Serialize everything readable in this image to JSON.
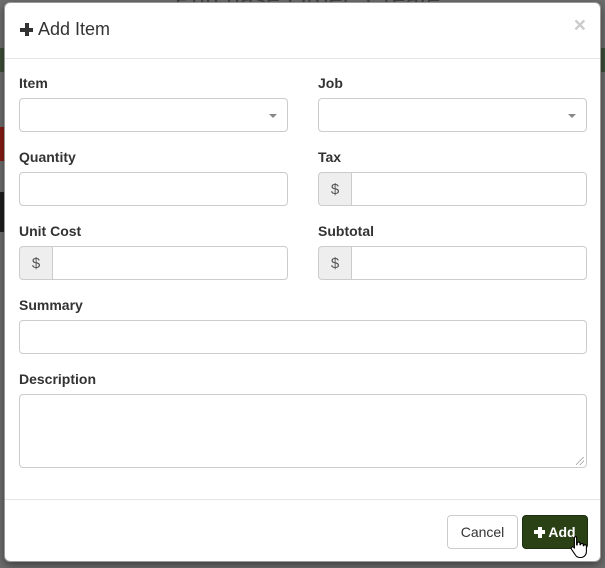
{
  "modal": {
    "title": "Add Item",
    "close_label": "×"
  },
  "form": {
    "item": {
      "label": "Item",
      "value": ""
    },
    "job": {
      "label": "Job",
      "value": ""
    },
    "quantity": {
      "label": "Quantity",
      "value": ""
    },
    "tax": {
      "label": "Tax",
      "prefix": "$",
      "value": ""
    },
    "unit_cost": {
      "label": "Unit Cost",
      "prefix": "$",
      "value": ""
    },
    "subtotal": {
      "label": "Subtotal",
      "prefix": "$",
      "value": ""
    },
    "summary": {
      "label": "Summary",
      "value": ""
    },
    "description": {
      "label": "Description",
      "value": ""
    }
  },
  "footer": {
    "cancel_label": "Cancel",
    "add_label": "Add"
  },
  "colors": {
    "add_button": "#2a4116",
    "backdrop": "#6e6e6e"
  },
  "icons": [
    "plus-icon",
    "close-icon",
    "chevron-down-icon",
    "hand-pointer-icon"
  ]
}
